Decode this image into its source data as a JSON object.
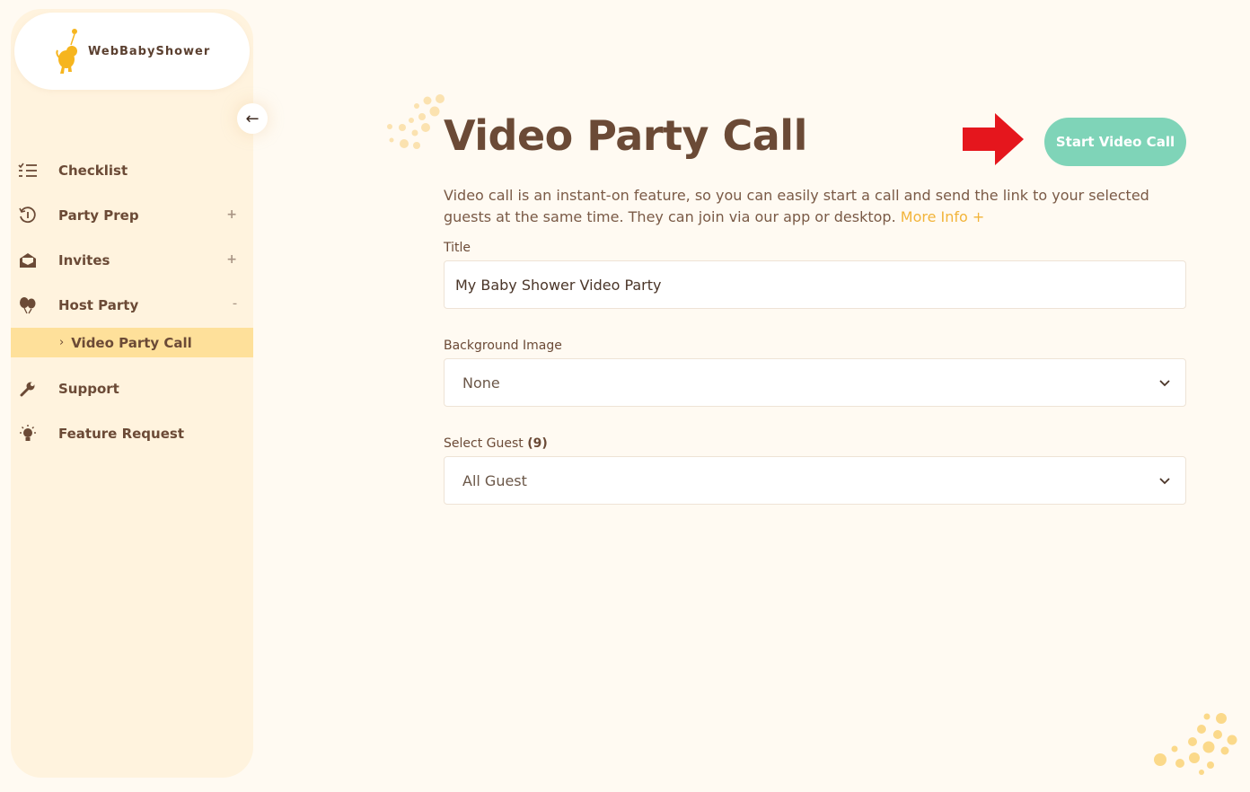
{
  "brand": {
    "name": "WebBabyShower"
  },
  "colors": {
    "background": "#fffaf2",
    "sidebar": "#fff3de",
    "active_item": "#fee09a",
    "accent_green": "#7fd4b8",
    "accent_yellow": "#f2b43a",
    "arrow_red": "#e5161d",
    "text_brown": "#6b4a36"
  },
  "sidebar": {
    "collapse_icon": "arrow-left-icon",
    "items": [
      {
        "label": "Checklist",
        "icon": "checklist-icon",
        "toggle": ""
      },
      {
        "label": "Party Prep",
        "icon": "history-icon",
        "toggle": "+"
      },
      {
        "label": "Invites",
        "icon": "envelope-open-icon",
        "toggle": "+"
      },
      {
        "label": "Host Party",
        "icon": "balloons-icon",
        "toggle": "–"
      },
      {
        "label": "Support",
        "icon": "wrench-icon",
        "toggle": ""
      },
      {
        "label": "Feature Request",
        "icon": "lightbulb-icon",
        "toggle": ""
      }
    ],
    "sub_items": [
      {
        "label": "Video Party Call",
        "active": true
      }
    ]
  },
  "main": {
    "title": "Video Party Call",
    "start_button": "Start Video Call",
    "description": "Video call is an instant-on feature, so you can easily start a call and send the link to your selected guests at the same time. They can join via our app or desktop.",
    "more_info": "More Info +",
    "fields": {
      "title_label": "Title",
      "title_value": "My Baby Shower Video Party",
      "background_label": "Background Image",
      "background_value": "None",
      "guest_label": "Select Guest",
      "guest_count": "(9)",
      "guest_value": "All Guest"
    }
  }
}
